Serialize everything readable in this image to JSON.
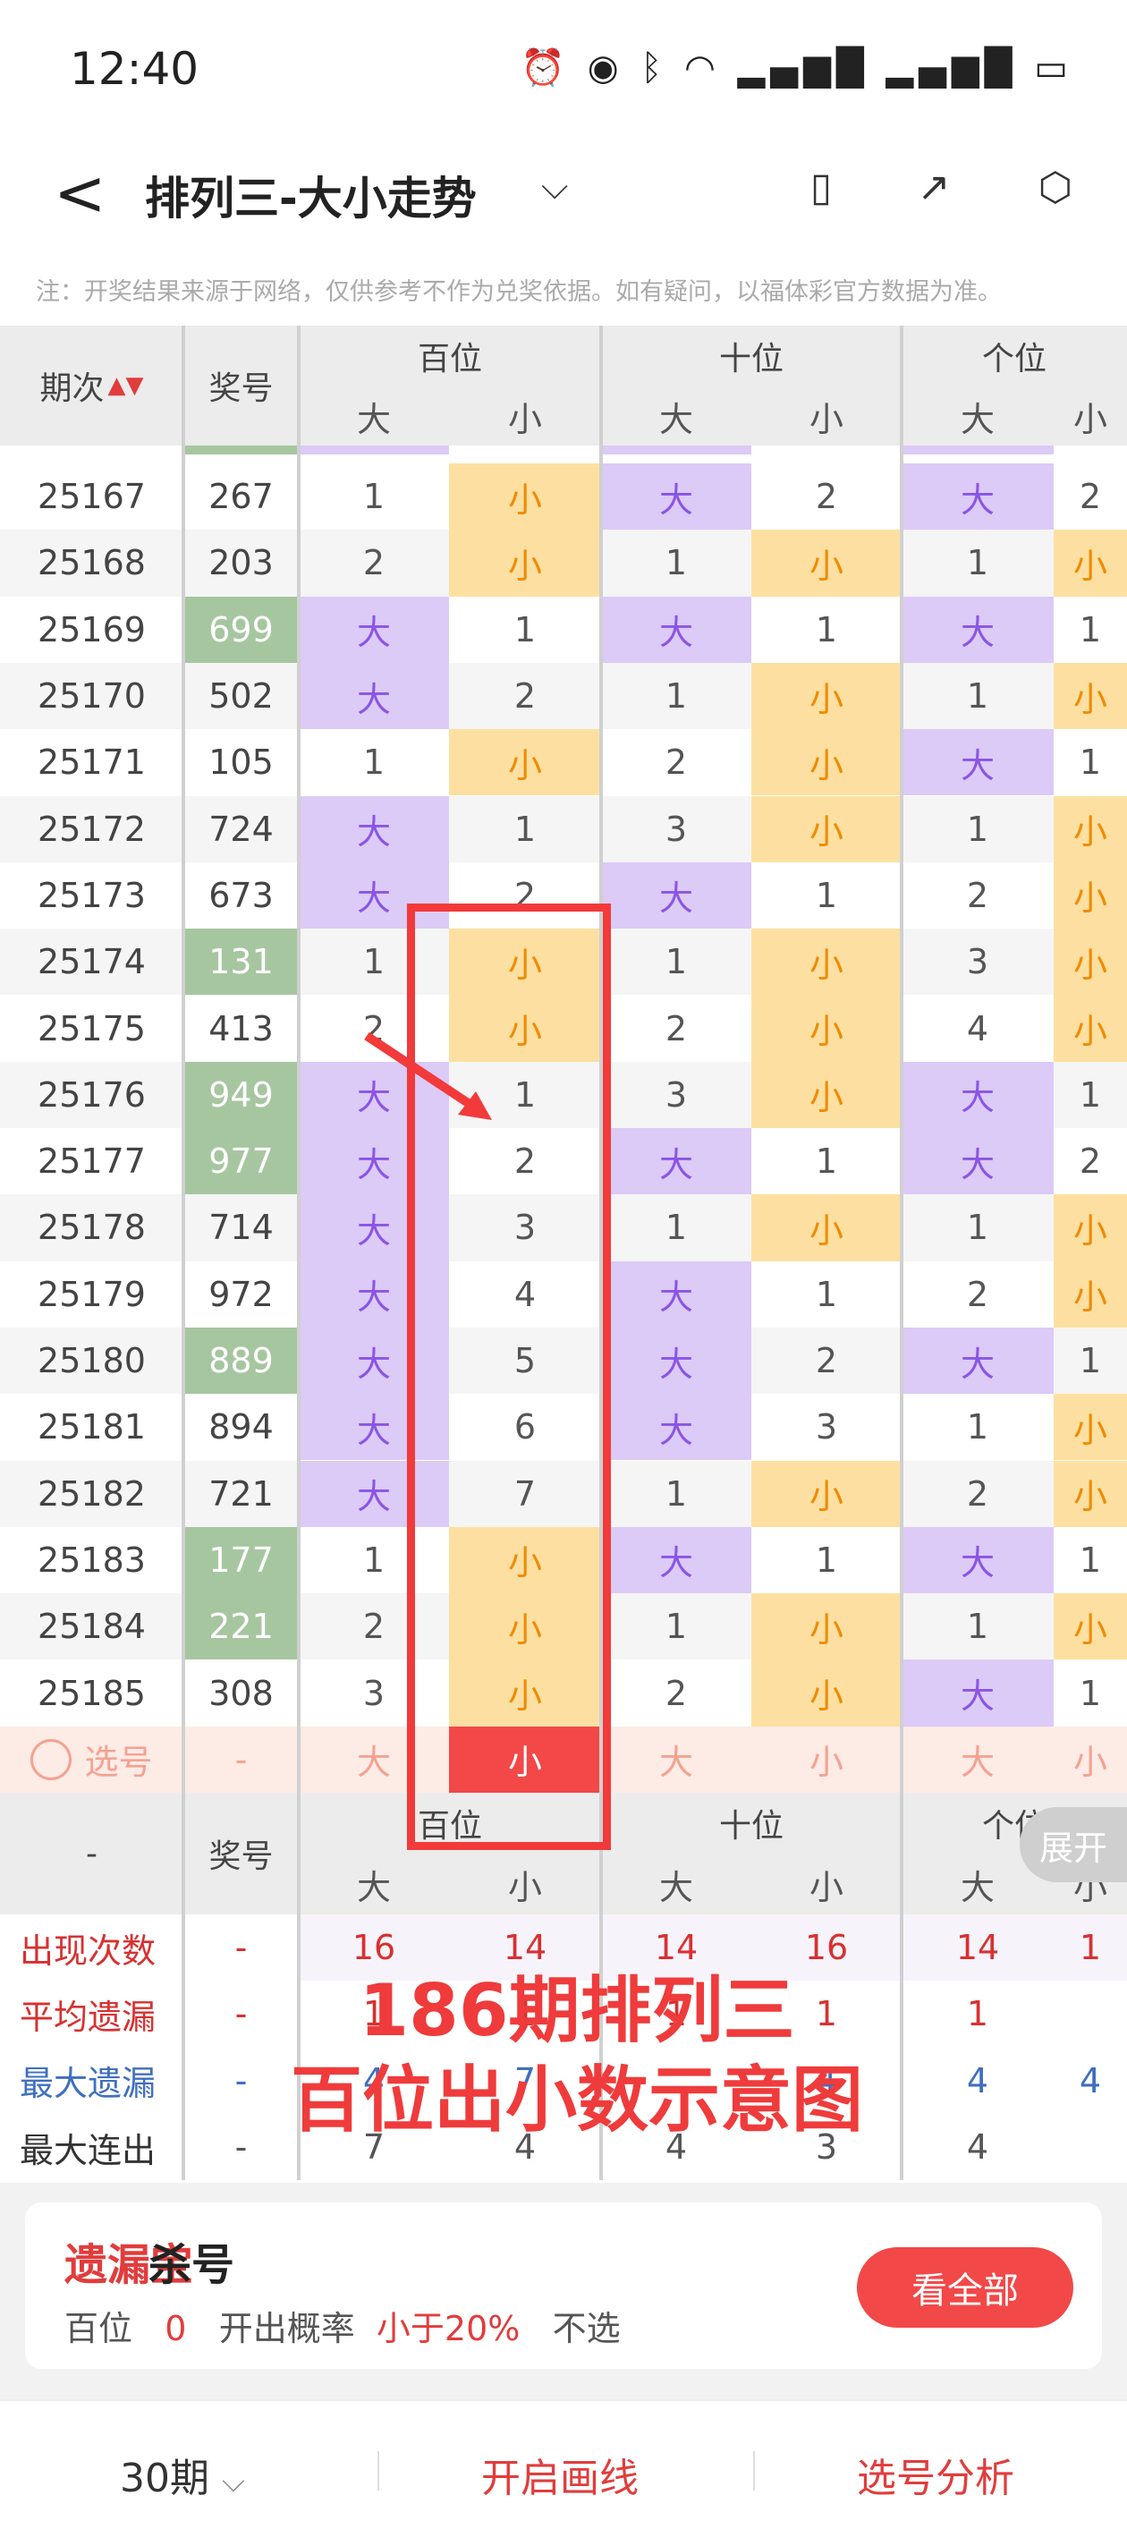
{
  "status_bar": {
    "time": "12:40",
    "icons": [
      "alarm-icon",
      "eye-icon",
      "bluetooth-icon",
      "wifi-icon",
      "signal-icon",
      "signal-icon",
      "battery-icon"
    ]
  },
  "header": {
    "back": "<",
    "title": "排列三-大小走势",
    "dropdown": "⌵"
  },
  "note": "注：开奖结果来源于网络，仅供参考不作为兑奖依据。如有疑问，以福体彩官方数据为准。",
  "table": {
    "col_period": "期次",
    "col_number": "奖号",
    "groups": [
      "百位",
      "十位",
      "个位"
    ],
    "sub": [
      "大",
      "小"
    ],
    "rows": [
      {
        "period": "25167",
        "num": "267",
        "green": false,
        "cells": [
          [
            "1",
            "n"
          ],
          [
            "小",
            "s"
          ],
          [
            "大",
            "b"
          ],
          [
            "2",
            "n"
          ],
          [
            "大",
            "b"
          ],
          [
            "2",
            "n"
          ]
        ]
      },
      {
        "period": "25168",
        "num": "203",
        "green": false,
        "cells": [
          [
            "2",
            "n"
          ],
          [
            "小",
            "s"
          ],
          [
            "1",
            "n"
          ],
          [
            "小",
            "s"
          ],
          [
            "1",
            "n"
          ],
          [
            "小",
            "s"
          ]
        ]
      },
      {
        "period": "25169",
        "num": "699",
        "green": true,
        "cells": [
          [
            "大",
            "b"
          ],
          [
            "1",
            "n"
          ],
          [
            "大",
            "b"
          ],
          [
            "1",
            "n"
          ],
          [
            "大",
            "b"
          ],
          [
            "1",
            "n"
          ]
        ]
      },
      {
        "period": "25170",
        "num": "502",
        "green": false,
        "cells": [
          [
            "大",
            "b"
          ],
          [
            "2",
            "n"
          ],
          [
            "1",
            "n"
          ],
          [
            "小",
            "s"
          ],
          [
            "1",
            "n"
          ],
          [
            "小",
            "s"
          ]
        ]
      },
      {
        "period": "25171",
        "num": "105",
        "green": false,
        "cells": [
          [
            "1",
            "n"
          ],
          [
            "小",
            "s"
          ],
          [
            "2",
            "n"
          ],
          [
            "小",
            "s"
          ],
          [
            "大",
            "b"
          ],
          [
            "1",
            "n"
          ]
        ]
      },
      {
        "period": "25172",
        "num": "724",
        "green": false,
        "cells": [
          [
            "大",
            "b"
          ],
          [
            "1",
            "n"
          ],
          [
            "3",
            "n"
          ],
          [
            "小",
            "s"
          ],
          [
            "1",
            "n"
          ],
          [
            "小",
            "s"
          ]
        ]
      },
      {
        "period": "25173",
        "num": "673",
        "green": false,
        "cells": [
          [
            "大",
            "b"
          ],
          [
            "2",
            "n"
          ],
          [
            "大",
            "b"
          ],
          [
            "1",
            "n"
          ],
          [
            "2",
            "n"
          ],
          [
            "小",
            "s"
          ]
        ]
      },
      {
        "period": "25174",
        "num": "131",
        "green": true,
        "cells": [
          [
            "1",
            "n"
          ],
          [
            "小",
            "s"
          ],
          [
            "1",
            "n"
          ],
          [
            "小",
            "s"
          ],
          [
            "3",
            "n"
          ],
          [
            "小",
            "s"
          ]
        ]
      },
      {
        "period": "25175",
        "num": "413",
        "green": false,
        "cells": [
          [
            "2",
            "n"
          ],
          [
            "小",
            "s"
          ],
          [
            "2",
            "n"
          ],
          [
            "小",
            "s"
          ],
          [
            "4",
            "n"
          ],
          [
            "小",
            "s"
          ]
        ]
      },
      {
        "period": "25176",
        "num": "949",
        "green": true,
        "cells": [
          [
            "大",
            "b"
          ],
          [
            "1",
            "n"
          ],
          [
            "3",
            "n"
          ],
          [
            "小",
            "s"
          ],
          [
            "大",
            "b"
          ],
          [
            "1",
            "n"
          ]
        ]
      },
      {
        "period": "25177",
        "num": "977",
        "green": true,
        "cells": [
          [
            "大",
            "b"
          ],
          [
            "2",
            "n"
          ],
          [
            "大",
            "b"
          ],
          [
            "1",
            "n"
          ],
          [
            "大",
            "b"
          ],
          [
            "2",
            "n"
          ]
        ]
      },
      {
        "period": "25178",
        "num": "714",
        "green": false,
        "cells": [
          [
            "大",
            "b"
          ],
          [
            "3",
            "n"
          ],
          [
            "1",
            "n"
          ],
          [
            "小",
            "s"
          ],
          [
            "1",
            "n"
          ],
          [
            "小",
            "s"
          ]
        ]
      },
      {
        "period": "25179",
        "num": "972",
        "green": false,
        "cells": [
          [
            "大",
            "b"
          ],
          [
            "4",
            "n"
          ],
          [
            "大",
            "b"
          ],
          [
            "1",
            "n"
          ],
          [
            "2",
            "n"
          ],
          [
            "小",
            "s"
          ]
        ]
      },
      {
        "period": "25180",
        "num": "889",
        "green": true,
        "cells": [
          [
            "大",
            "b"
          ],
          [
            "5",
            "n"
          ],
          [
            "大",
            "b"
          ],
          [
            "2",
            "n"
          ],
          [
            "大",
            "b"
          ],
          [
            "1",
            "n"
          ]
        ]
      },
      {
        "period": "25181",
        "num": "894",
        "green": false,
        "cells": [
          [
            "大",
            "b"
          ],
          [
            "6",
            "n"
          ],
          [
            "大",
            "b"
          ],
          [
            "3",
            "n"
          ],
          [
            "1",
            "n"
          ],
          [
            "小",
            "s"
          ]
        ]
      },
      {
        "period": "25182",
        "num": "721",
        "green": false,
        "cells": [
          [
            "大",
            "b"
          ],
          [
            "7",
            "n"
          ],
          [
            "1",
            "n"
          ],
          [
            "小",
            "s"
          ],
          [
            "2",
            "n"
          ],
          [
            "小",
            "s"
          ]
        ]
      },
      {
        "period": "25183",
        "num": "177",
        "green": true,
        "cells": [
          [
            "1",
            "n"
          ],
          [
            "小",
            "s"
          ],
          [
            "大",
            "b"
          ],
          [
            "1",
            "n"
          ],
          [
            "大",
            "b"
          ],
          [
            "1",
            "n"
          ]
        ]
      },
      {
        "period": "25184",
        "num": "221",
        "green": true,
        "cells": [
          [
            "2",
            "n"
          ],
          [
            "小",
            "s"
          ],
          [
            "1",
            "n"
          ],
          [
            "小",
            "s"
          ],
          [
            "1",
            "n"
          ],
          [
            "小",
            "s"
          ]
        ]
      },
      {
        "period": "25185",
        "num": "308",
        "green": false,
        "cells": [
          [
            "3",
            "n"
          ],
          [
            "小",
            "s"
          ],
          [
            "2",
            "n"
          ],
          [
            "小",
            "s"
          ],
          [
            "大",
            "b"
          ],
          [
            "1",
            "n"
          ]
        ]
      }
    ],
    "select_row": {
      "label": "选号",
      "num": "-",
      "cells": [
        "大",
        "小",
        "大",
        "小",
        "大",
        "小"
      ]
    },
    "stats_header": {
      "period": "-",
      "num": "奖号"
    },
    "stats": [
      {
        "label": "出现次数",
        "color": "red",
        "num": "-",
        "values": [
          "16",
          "14",
          "14",
          "16",
          "14",
          "1"
        ]
      },
      {
        "label": "平均遗漏",
        "color": "red",
        "num": "-",
        "values": [
          "1",
          "1",
          "1",
          "1",
          "1",
          ""
        ]
      },
      {
        "label": "最大遗漏",
        "color": "blue",
        "num": "-",
        "values": [
          "4",
          "7",
          "",
          "4",
          "4",
          "4"
        ]
      },
      {
        "label": "最大连出",
        "color": "dark",
        "num": "-",
        "values": [
          "7",
          "4",
          "4",
          "3",
          "4",
          ""
        ]
      }
    ]
  },
  "annotation": {
    "line1": "186期排列三",
    "line2": "百位出小数示意图"
  },
  "expand_button": "展开",
  "kill_card": {
    "brand": "遗漏宝",
    "title": "杀号",
    "pos": "百位",
    "digit": "0",
    "prob_label": "开出概率",
    "prob": "小于20%",
    "advice": "不选",
    "button": "看全部"
  },
  "bottom_bar": {
    "periods": "30期",
    "draw": "开启画线",
    "analysis": "选号分析"
  }
}
